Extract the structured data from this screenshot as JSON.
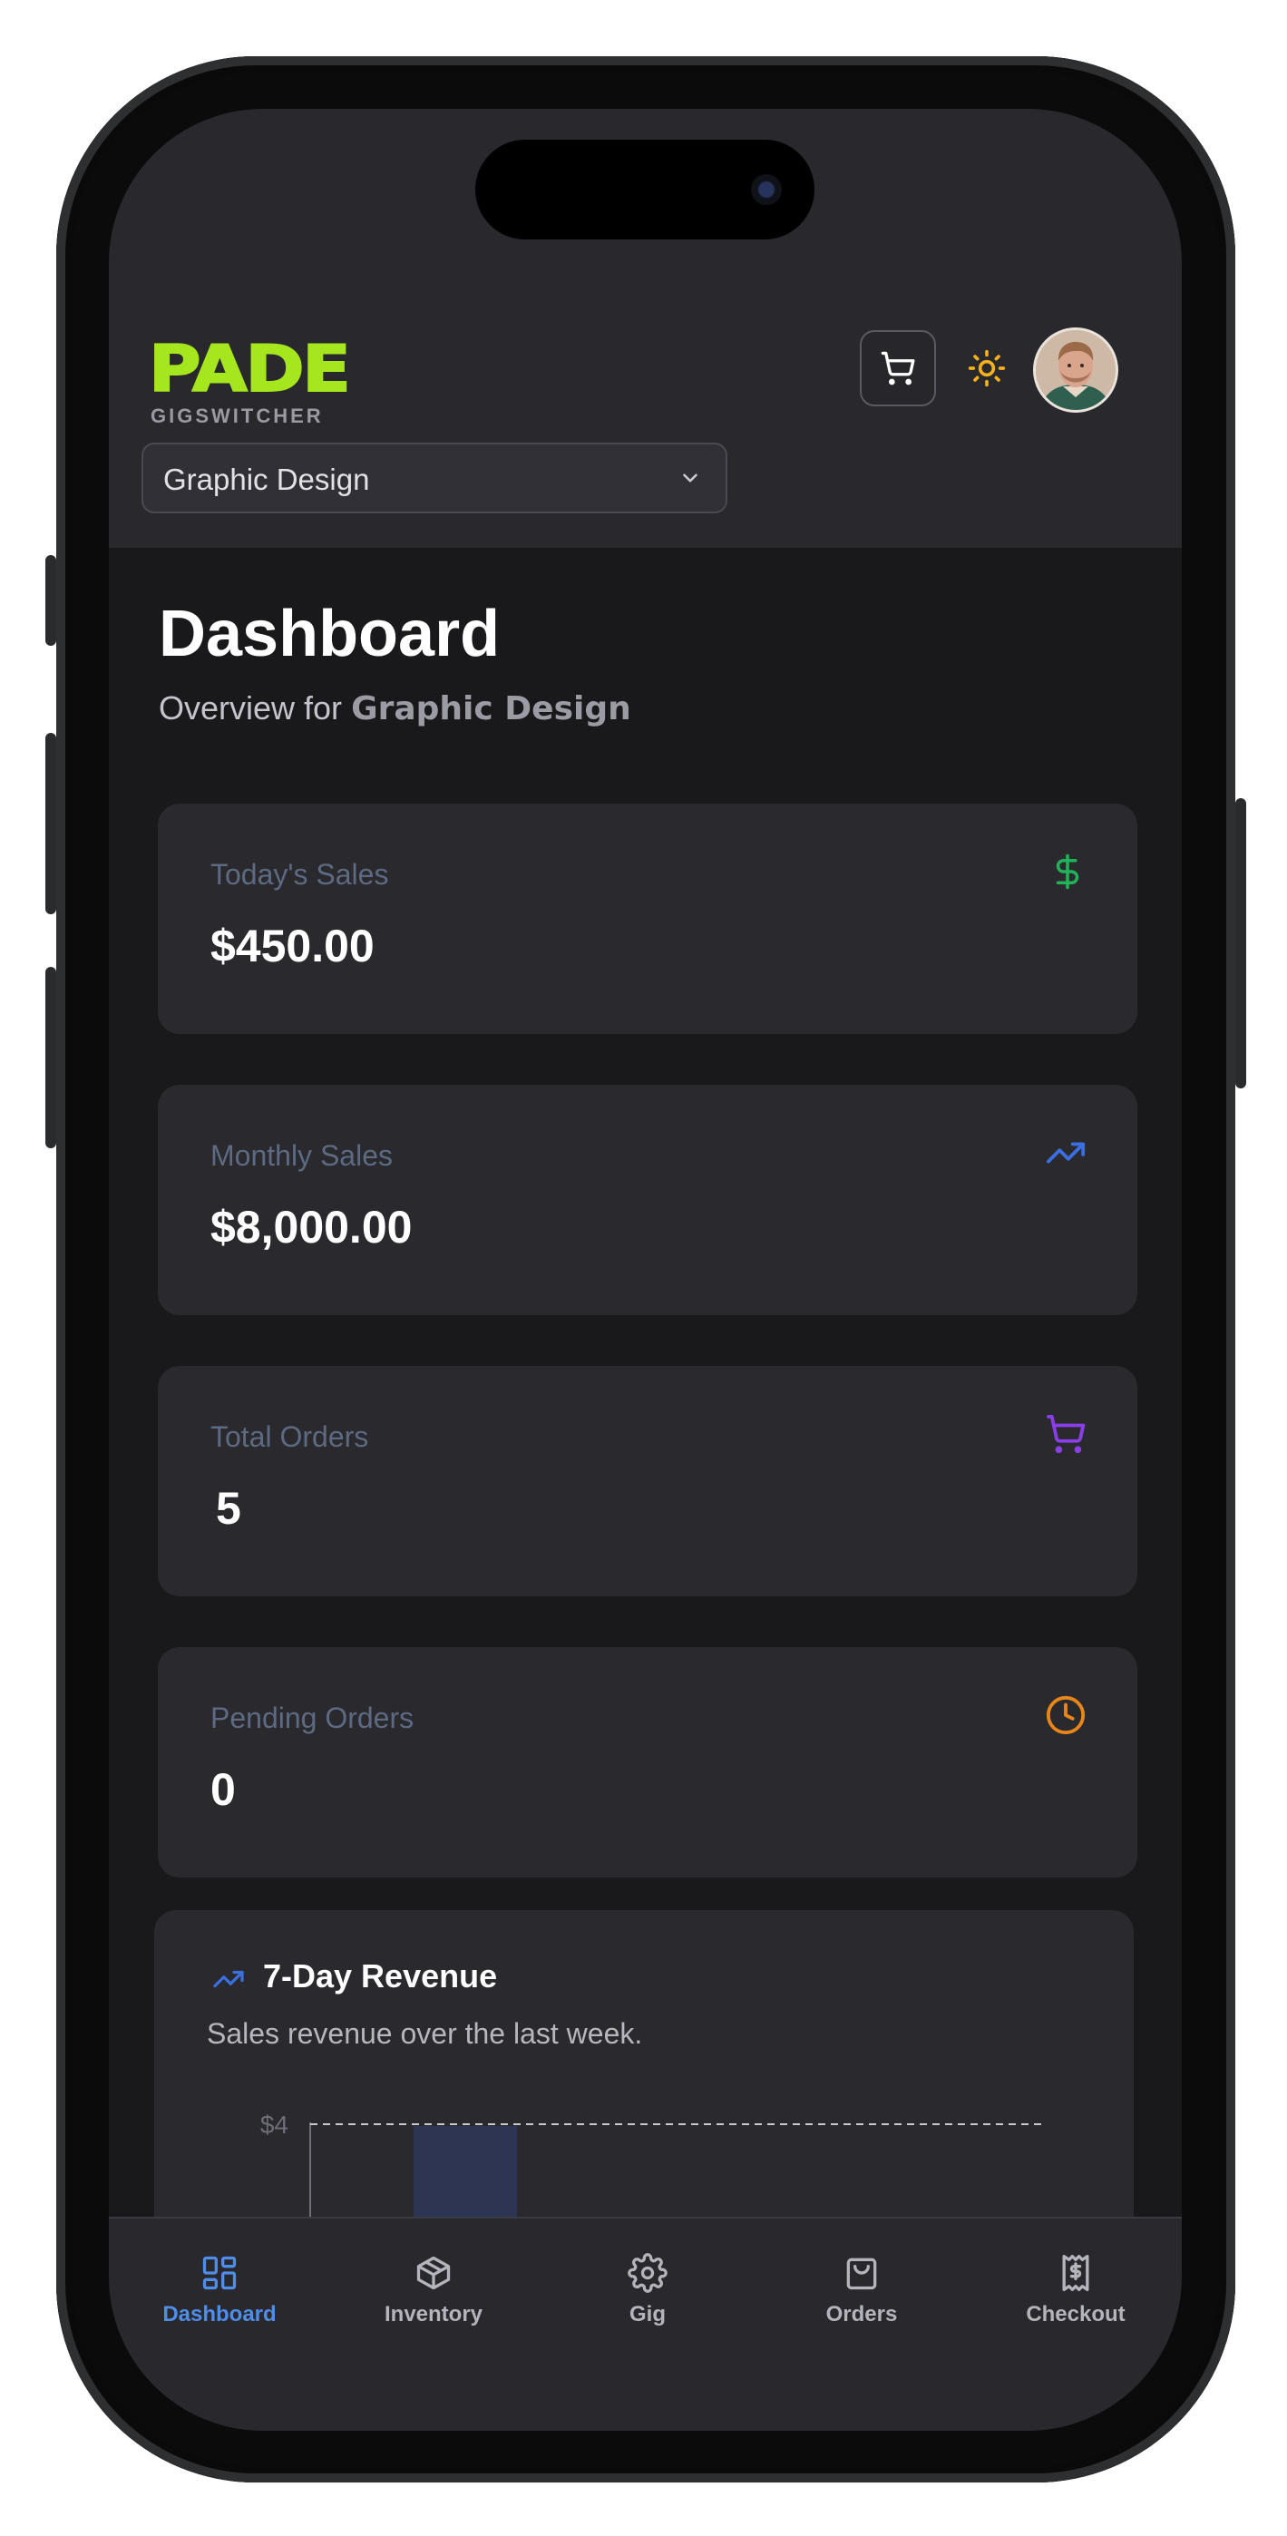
{
  "brand": {
    "name": "PADE",
    "tagline": "GIGSWITCHER"
  },
  "gig_select": {
    "value": "Graphic Design"
  },
  "header": {
    "cart_icon": "cart-icon",
    "theme_icon": "sun-icon",
    "avatar": "user-avatar"
  },
  "page": {
    "title": "Dashboard",
    "subtitle_prefix": "Overview for",
    "subtitle_gig": "Graphic Design"
  },
  "stats": [
    {
      "label": "Today's Sales",
      "value": "$450.00",
      "icon": "dollar-icon",
      "color": "#22b35a"
    },
    {
      "label": "Monthly Sales",
      "value": "$8,000.00",
      "icon": "trending-up-icon",
      "color": "#3b6fe0"
    },
    {
      "label": "Total Orders",
      "value": "5",
      "icon": "cart-icon",
      "color": "#8a3fe6"
    },
    {
      "label": "Pending Orders",
      "value": "0",
      "icon": "clock-icon",
      "color": "#e8861a"
    }
  ],
  "revenue": {
    "title": "7-Day Revenue",
    "subtitle": "Sales revenue over the last week.",
    "icon": "trending-up-icon"
  },
  "chart_data": {
    "type": "bar",
    "title": "7-Day Revenue",
    "y_tick_labels": [
      "$4"
    ],
    "gridline": "dashed",
    "note": "chart cropped by viewport; only top of first bar visible"
  },
  "nav": [
    {
      "label": "Dashboard",
      "icon": "grid-icon",
      "active": true
    },
    {
      "label": "Inventory",
      "icon": "box-icon",
      "active": false
    },
    {
      "label": "Gig",
      "icon": "gear-icon",
      "active": false
    },
    {
      "label": "Orders",
      "icon": "bag-icon",
      "active": false
    },
    {
      "label": "Checkout",
      "icon": "receipt-icon",
      "active": false
    }
  ],
  "colors": {
    "accent": "#a6e61e",
    "background": "#19191c",
    "card": "#29292e",
    "nav_active": "#4f8dea"
  }
}
